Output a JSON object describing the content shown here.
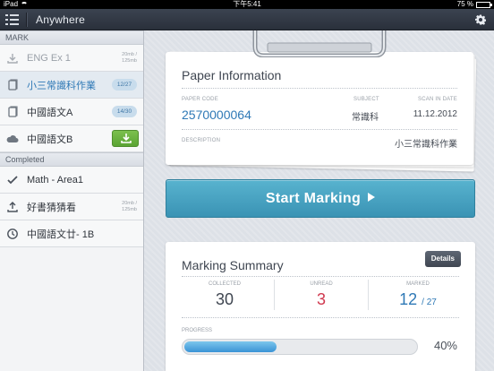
{
  "status_bar": {
    "device": "iPad",
    "time": "下午5:41",
    "battery": "75 %"
  },
  "nav": {
    "title": "Anywhere"
  },
  "sidebar": {
    "sections": [
      {
        "header": "MARK",
        "items": [
          {
            "label": "ENG Ex 1",
            "icon": "download-icon",
            "size": "20mb / 125mb",
            "faded": true
          },
          {
            "label": "小三常識科作業",
            "icon": "document-icon",
            "badge": "12/27",
            "active": true
          },
          {
            "label": "中國語文A",
            "icon": "document-icon",
            "badge": "14/30"
          },
          {
            "label": "中國語文B",
            "icon": "cloud-icon",
            "action": "download-button"
          }
        ]
      },
      {
        "header": "Completed",
        "items": [
          {
            "label": "Math - Area1",
            "icon": "check-icon"
          },
          {
            "label": "好書猜猜看",
            "icon": "upload-icon",
            "size": "20mb / 125mb"
          },
          {
            "label": "中國語文廿- 1B",
            "icon": "clock-icon"
          }
        ]
      }
    ]
  },
  "paper_info": {
    "title": "Paper Information",
    "code_label": "PAPER CODE",
    "code": "2570000064",
    "subject_label": "SUBJECT",
    "subject": "常識科",
    "date_label": "SCAN IN DATE",
    "date": "11.12.2012",
    "description_label": "DESCRIPTION",
    "description": "小三常識科作業"
  },
  "start_button": {
    "label": "Start Marking"
  },
  "summary": {
    "title": "Marking Summary",
    "details_label": "Details",
    "collected_label": "COLLECTED",
    "collected": "30",
    "unread_label": "UNREAD",
    "unread": "3",
    "marked_label": "MARKED",
    "marked": "12",
    "marked_total": "/ 27",
    "progress_label": "PROGRESS",
    "progress_text": "40%",
    "progress_value": 0.4
  },
  "colors": {
    "accent_blue": "#2f79b6",
    "unread_red": "#d0394f",
    "start_button": "#49a3c3",
    "download_green": "#6bb240"
  }
}
